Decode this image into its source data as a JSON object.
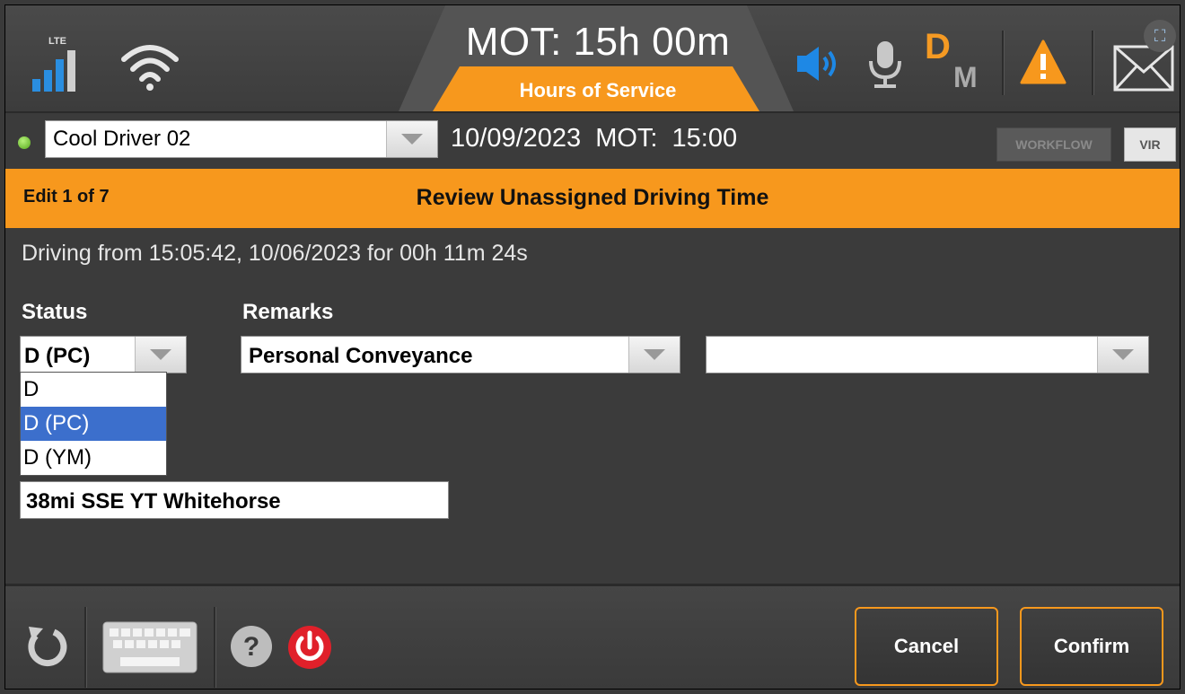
{
  "topbar": {
    "lte_label": "LTE",
    "mot_title": "MOT: 15h 00m",
    "hos_title": "Hours of Service",
    "dm_d": "D",
    "dm_m": "M",
    "icons": [
      "signal-icon",
      "wifi-icon",
      "speaker-icon",
      "microphone-icon",
      "warning-icon",
      "mail-icon",
      "screenshot-icon"
    ],
    "colors": {
      "accent_orange": "#f7981d",
      "speaker_blue": "#1e88e5"
    }
  },
  "driver_row": {
    "driver_name": "Cool Driver 02",
    "date": "10/09/2023",
    "mot": "MOT: 15:00",
    "workflow_label": "WORKFLOW",
    "vir_label": "VIR",
    "status_led_color": "#56a81c"
  },
  "edit_header": {
    "count": "Edit 1 of 7",
    "title": "Review Unassigned Driving Time"
  },
  "form": {
    "driving_line": "Driving from 15:05:42, 10/06/2023 for 00h 11m 24s",
    "status_label": "Status",
    "remarks_label": "Remarks",
    "status_value": "D (PC)",
    "status_options": [
      {
        "label": "D",
        "selected": false
      },
      {
        "label": "D (PC)",
        "selected": true
      },
      {
        "label": "D (YM)",
        "selected": false
      }
    ],
    "remarks_value": "Personal Conveyance",
    "remarks_secondary_value": "",
    "location_value": "38mi SSE YT Whitehorse"
  },
  "bottombar": {
    "cancel_label": "Cancel",
    "confirm_label": "Confirm",
    "help_glyph": "?"
  }
}
